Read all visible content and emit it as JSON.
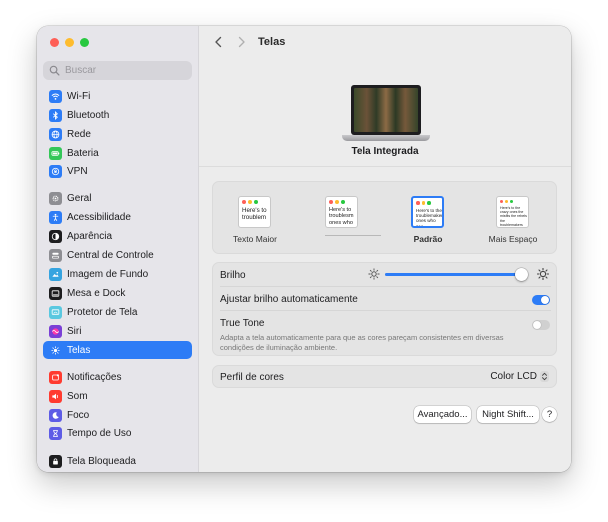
{
  "sidebar": {
    "search_placeholder": "Buscar",
    "items": [
      {
        "label": "Wi-Fi",
        "icon": "wifi-icon",
        "color": "#2d7cf6"
      },
      {
        "label": "Bluetooth",
        "icon": "bluetooth-icon",
        "color": "#2d7cf6"
      },
      {
        "label": "Rede",
        "icon": "globe-icon",
        "color": "#2d7cf6"
      },
      {
        "label": "Bateria",
        "icon": "battery-icon",
        "color": "#34c759"
      },
      {
        "label": "VPN",
        "icon": "vpn-icon",
        "color": "#2d7cf6"
      },
      {
        "label": "Geral",
        "icon": "gear-icon",
        "color": "#8e8e93"
      },
      {
        "label": "Acessibilidade",
        "icon": "accessibility-icon",
        "color": "#2d7cf6"
      },
      {
        "label": "Aparência",
        "icon": "appearance-icon",
        "color": "#1d1d1f"
      },
      {
        "label": "Central de Controle",
        "icon": "control-center-icon",
        "color": "#8e8e93"
      },
      {
        "label": "Imagem de Fundo",
        "icon": "wallpaper-icon",
        "color": "#36a4e0"
      },
      {
        "label": "Mesa e Dock",
        "icon": "dock-icon",
        "color": "#1d1d1f"
      },
      {
        "label": "Protetor de Tela",
        "icon": "screensaver-icon",
        "color": "#5ac8e0"
      },
      {
        "label": "Siri",
        "icon": "siri-icon",
        "color": "#7a3fd6"
      },
      {
        "label": "Telas",
        "icon": "display-sun-icon",
        "color": "#2d7cf6"
      },
      {
        "label": "Notificações",
        "icon": "notifications-icon",
        "color": "#ff3b30"
      },
      {
        "label": "Som",
        "icon": "speaker-icon",
        "color": "#ff3b30"
      },
      {
        "label": "Foco",
        "icon": "moon-icon",
        "color": "#5e5ce6"
      },
      {
        "label": "Tempo de Uso",
        "icon": "hourglass-icon",
        "color": "#5e5ce6"
      },
      {
        "label": "Tela Bloqueada",
        "icon": "lock-screen-icon",
        "color": "#1d1d1f"
      }
    ],
    "active_index": 13
  },
  "toolbar": {
    "title": "Telas"
  },
  "display": {
    "name": "Tela Integrada"
  },
  "resolution": {
    "options": [
      {
        "label": "Texto Maior",
        "thumb_text": "Here's to troublem"
      },
      {
        "label": "",
        "thumb_text": "Here's to troublesm ones who"
      },
      {
        "label": "Padrão",
        "thumb_text": "Here's to the troublemakers ones who see"
      },
      {
        "label": "Mais Espaço",
        "thumb_text": "Here's to the crazy ones the misfits the rebels the troublemakers"
      }
    ],
    "selected_index": 2
  },
  "settings": {
    "brightness_label": "Brilho",
    "brightness_value": 0.97,
    "auto_brightness_label": "Ajustar brilho automaticamente",
    "auto_brightness_on": true,
    "true_tone_label": "True Tone",
    "true_tone_on": false,
    "true_tone_desc": "Adapta a tela automaticamente para que as cores pareçam consistentes em diversas condições de iluminação ambiente."
  },
  "profile": {
    "label": "Perfil de cores",
    "value": "Color LCD"
  },
  "buttons": {
    "advanced": "Avançado...",
    "night_shift": "Night Shift...",
    "help": "?"
  },
  "colors": {
    "accent": "#2d7cf6"
  }
}
